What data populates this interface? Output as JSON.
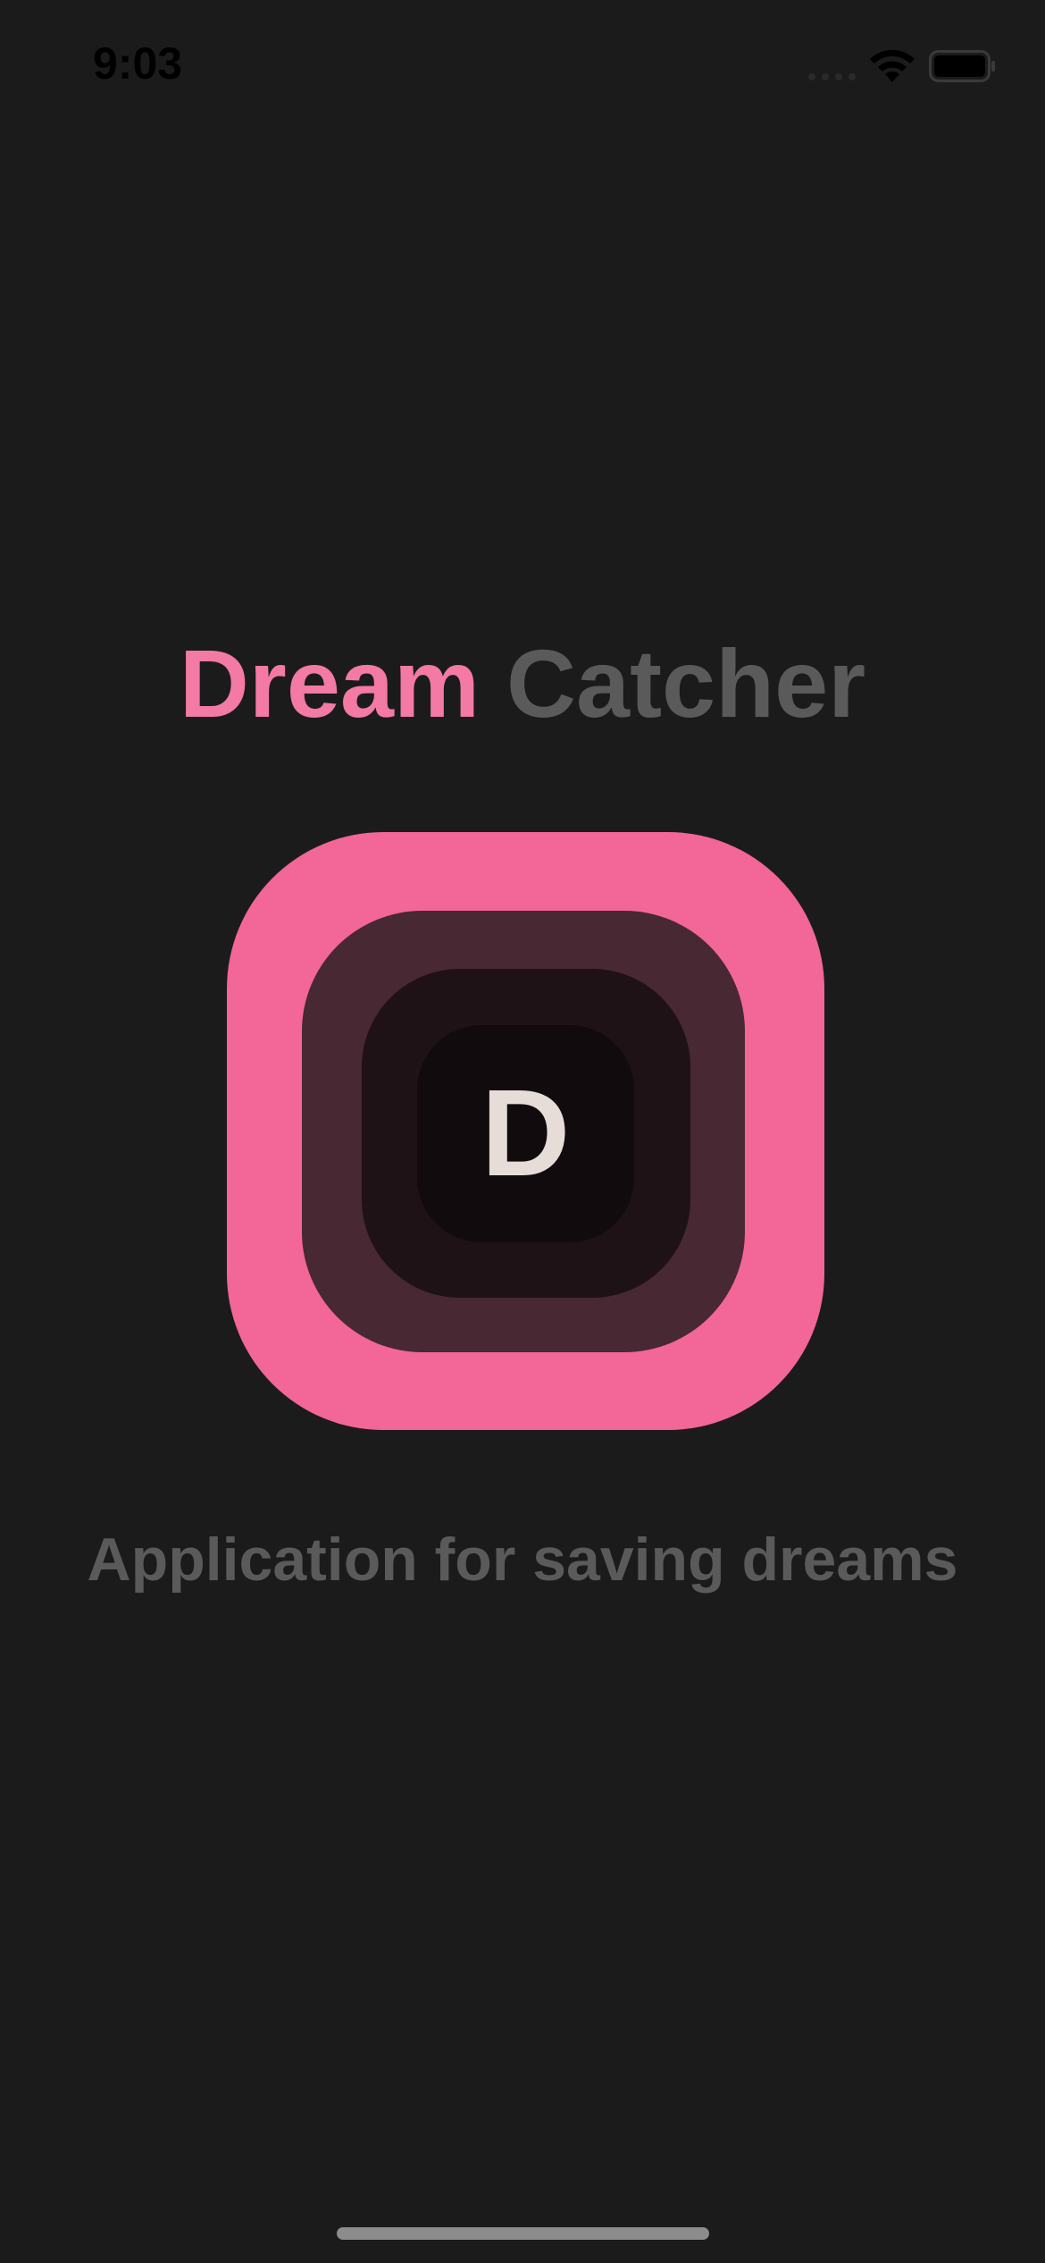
{
  "status_bar": {
    "time": "9:03"
  },
  "title": {
    "accent": "Dream",
    "rest": "Catcher"
  },
  "logo": {
    "letter": "D"
  },
  "subtitle": "Application for saving dreams",
  "colors": {
    "background": "#1b1b1c",
    "accent": "#f27aa4",
    "muted_text": "#5a5a5a"
  },
  "icons": [
    "signal-icon",
    "wifi-icon",
    "battery-icon"
  ]
}
